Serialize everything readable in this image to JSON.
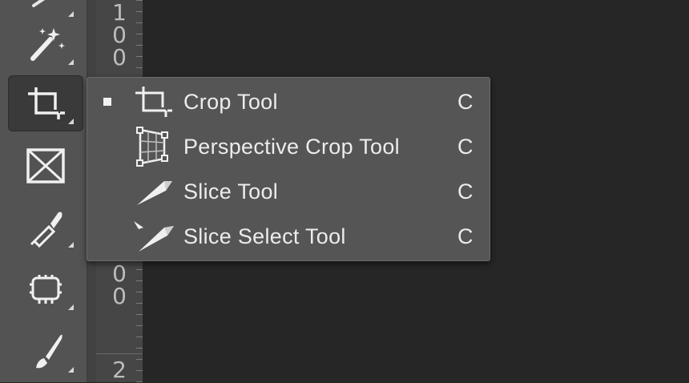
{
  "toolbar": {
    "tools": [
      {
        "name": "magic-wand-tool",
        "icon": "magic-wand-icon"
      },
      {
        "name": "crop-tool",
        "icon": "crop-icon",
        "active": true
      },
      {
        "name": "frame-tool",
        "icon": "frame-icon"
      },
      {
        "name": "eyedropper-tool",
        "icon": "eyedropper-icon"
      },
      {
        "name": "content-aware-tool",
        "icon": "patch-icon"
      },
      {
        "name": "brush-tool",
        "icon": "brush-icon"
      }
    ]
  },
  "ruler": {
    "top_digits": [
      "1",
      "0",
      "0"
    ],
    "lower_digits": [
      "0",
      "0"
    ],
    "bottom_digit": "2"
  },
  "flyout": {
    "items": [
      {
        "label": "Crop Tool",
        "shortcut": "C",
        "selected": true,
        "icon": "crop-icon"
      },
      {
        "label": "Perspective Crop Tool",
        "shortcut": "C",
        "selected": false,
        "icon": "perspective-crop-icon"
      },
      {
        "label": "Slice Tool",
        "shortcut": "C",
        "selected": false,
        "icon": "slice-icon"
      },
      {
        "label": "Slice Select Tool",
        "shortcut": "C",
        "selected": false,
        "icon": "slice-select-icon"
      }
    ]
  },
  "colors": {
    "toolbar_bg": "#535353",
    "menu_bg": "#555555",
    "canvas_bg": "#262626",
    "text": "#ececec"
  }
}
